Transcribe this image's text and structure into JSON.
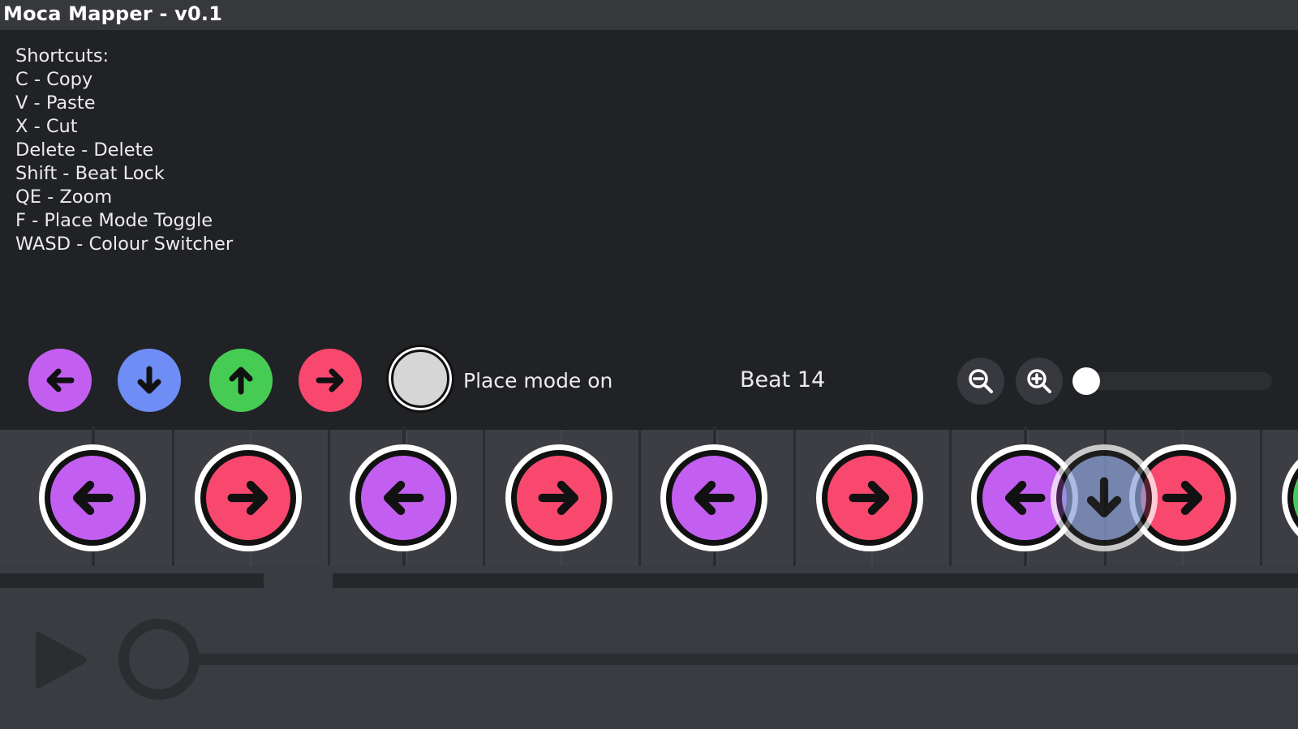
{
  "app": {
    "title": "Moca Mapper - v0.1"
  },
  "shortcuts": {
    "heading": "Shortcuts:",
    "items": [
      "C - Copy",
      "V - Paste",
      "X - Cut",
      "Delete - Delete",
      "Shift - Beat Lock",
      "QE - Zoom",
      "F - Place Mode Toggle",
      "WASD - Colour Switcher"
    ]
  },
  "colors": {
    "purple": "#c35ff0",
    "blue": "#6e8df5",
    "green": "#46cc55",
    "red": "#f8486e",
    "ghost_blue": "#8ca1d8"
  },
  "color_buttons": [
    {
      "direction": "left",
      "color": "purple",
      "icon": "arrow-left-icon"
    },
    {
      "direction": "down",
      "color": "blue",
      "icon": "arrow-down-icon"
    },
    {
      "direction": "up",
      "color": "green",
      "icon": "arrow-up-icon"
    },
    {
      "direction": "right",
      "color": "red",
      "icon": "arrow-right-icon"
    }
  ],
  "place_mode": {
    "label": "Place mode on"
  },
  "beat": {
    "label": "Beat 14"
  },
  "zoom": {
    "out_icon": "zoom-out-icon",
    "in_icon": "zoom-in-icon",
    "level": 0.02
  },
  "timeline": {
    "notes": [
      {
        "direction": "left",
        "color": "purple"
      },
      {
        "direction": "right",
        "color": "red"
      },
      {
        "direction": "left",
        "color": "purple"
      },
      {
        "direction": "right",
        "color": "red"
      },
      {
        "direction": "left",
        "color": "purple"
      },
      {
        "direction": "right",
        "color": "red"
      },
      {
        "direction": "left",
        "color": "purple"
      },
      {
        "direction": "right",
        "color": "red"
      },
      {
        "direction": "down",
        "color": "ghost_blue",
        "ghost": true
      }
    ]
  },
  "player": {
    "play_icon": "play-icon",
    "progress": 0.0
  }
}
